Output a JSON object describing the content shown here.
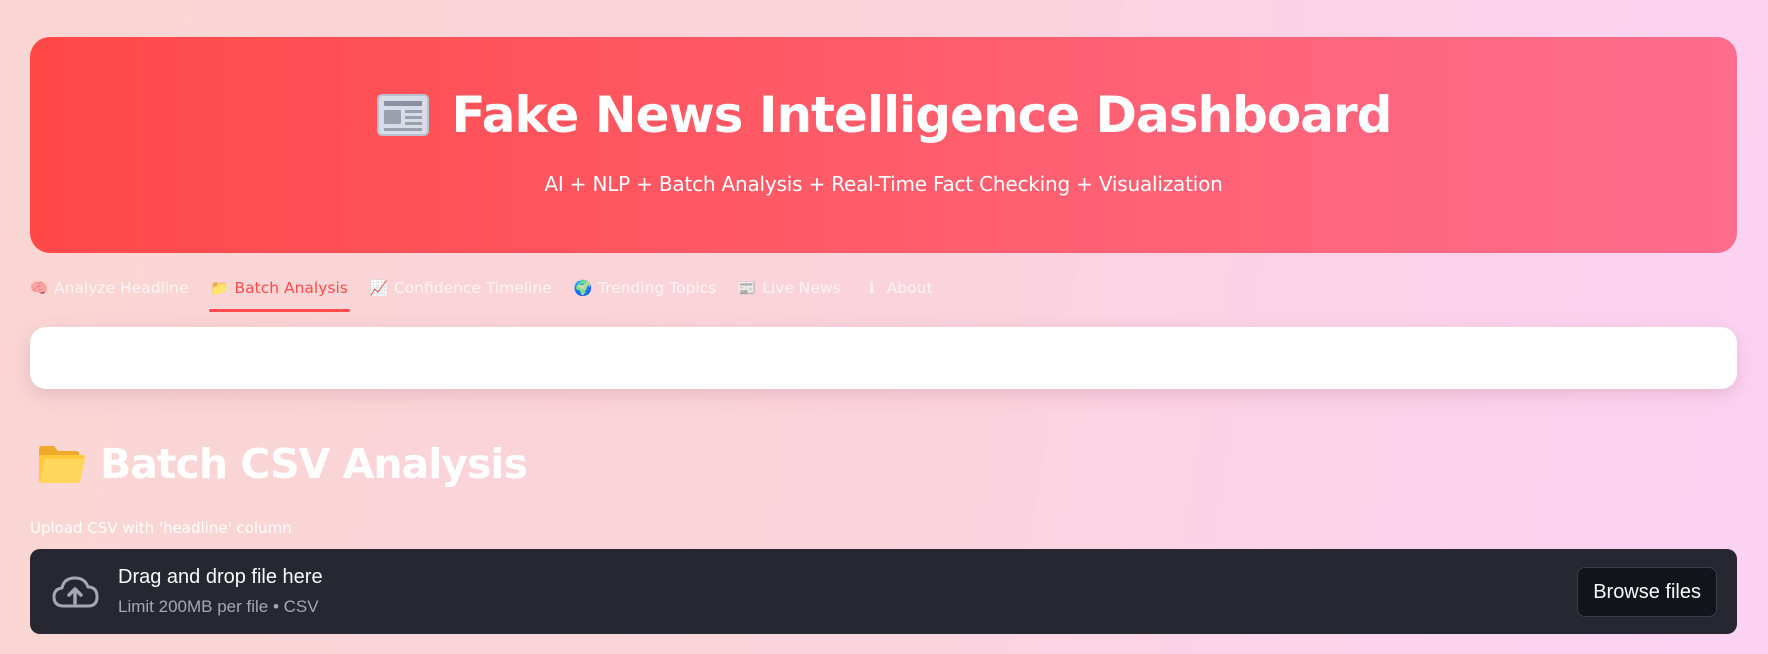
{
  "header": {
    "icon": "newspaper-icon",
    "title": "Fake News Intelligence Dashboard",
    "subtitle": "AI + NLP + Batch Analysis + Real-Time Fact Checking + Visualization"
  },
  "tabs": [
    {
      "icon": "🧠",
      "label": "Analyze Headline",
      "active": false
    },
    {
      "icon": "📁",
      "label": "Batch Analysis",
      "active": true
    },
    {
      "icon": "📈",
      "label": "Confidence Timeline",
      "active": false
    },
    {
      "icon": "🌍",
      "label": "Trending Topics",
      "active": false
    },
    {
      "icon": "📰",
      "label": "Live News",
      "active": false
    },
    {
      "icon": "ℹ",
      "label": "About",
      "active": false
    }
  ],
  "section": {
    "icon": "open-folder-icon",
    "title": "Batch CSV Analysis"
  },
  "uploader": {
    "label": "Upload CSV with 'headline' column",
    "drop_text": "Drag and drop file here",
    "limit_text": "Limit 200MB per file • CSV",
    "browse_label": "Browse files"
  },
  "colors": {
    "accent": "#ff4b4b",
    "hero_start": "#ff4848",
    "hero_end": "#ff6d8c",
    "dropzone_bg": "#262730"
  }
}
